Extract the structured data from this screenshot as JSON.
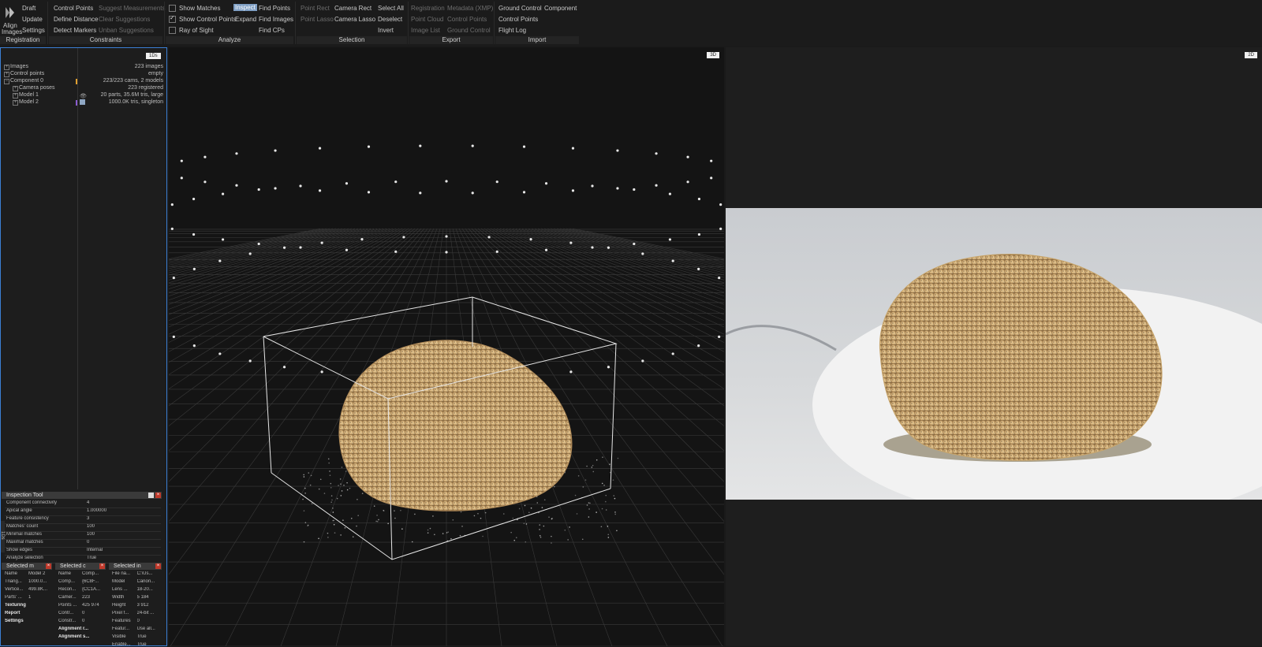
{
  "ribbon": {
    "registration": {
      "align_label_1": "Align",
      "align_label_2": "Images",
      "draft": "Draft",
      "update": "Update",
      "settings": "Settings",
      "group": "Registration"
    },
    "constraints": {
      "control_points": "Control Points",
      "define_distance": "Define Distance",
      "detect_markers": "Detect Markers",
      "suggest_measurements": "Suggest Measurements",
      "clear_suggestions": "Clear Suggestions",
      "unban_suggestions": "Unban Suggestions",
      "group": "Constraints"
    },
    "analyze": {
      "show_matches": "Show Matches",
      "show_control_points": "Show Control Points",
      "ray_of_sight": "Ray of Sight",
      "inspect": "Inspect",
      "expand": "Expand",
      "find_points": "Find Points",
      "find_images": "Find Images",
      "find_cps": "Find CPs",
      "group": "Analyze"
    },
    "selection": {
      "point_rect": "Point Rect",
      "point_lasso": "Point Lasso",
      "camera_rect": "Camera Rect",
      "camera_lasso": "Camera Lasso",
      "select_all": "Select All",
      "deselect": "Deselect",
      "invert": "Invert",
      "group": "Selection"
    },
    "export": {
      "registration": "Registration",
      "point_cloud": "Point Cloud",
      "image_list": "Image List",
      "metadata": "Metadata (XMP)",
      "control_points": "Control Points",
      "ground_control": "Ground Control",
      "group": "Export"
    },
    "import": {
      "ground_control": "Ground Control",
      "component": "Component",
      "control_points": "Control Points",
      "flight_log": "Flight Log",
      "group": "Import"
    }
  },
  "panel1": {
    "tag": "1Ds",
    "tree": [
      {
        "label": "Images",
        "value": "223 images"
      },
      {
        "label": "Control points",
        "value": "empty"
      },
      {
        "label": "Component 0",
        "value": "223/223 cams, 2 models"
      },
      {
        "label": "Camera poses",
        "value": "223 registered"
      },
      {
        "label": "Model 1",
        "value": "20 parts, 35.6M tris, large"
      },
      {
        "label": "Model 2",
        "value": "1000.0K tris, singleton"
      }
    ]
  },
  "viewport3d": {
    "tag": "3D"
  },
  "viewport2d": {
    "tag": "2D"
  },
  "inspection": {
    "title": "Inspection Tool",
    "rows": [
      {
        "k": "Component connectivity",
        "v": "4"
      },
      {
        "k": "Apical angle",
        "v": "1.000000"
      },
      {
        "k": "Feature consistency",
        "v": "3"
      },
      {
        "k": "Matches' count",
        "v": "100"
      },
      {
        "k": "Minimal matches",
        "v": "100"
      },
      {
        "k": "Maximal matches",
        "v": "0"
      },
      {
        "k": "Show edges",
        "v": "Internal"
      },
      {
        "k": "Analyze selection",
        "v": "True"
      }
    ],
    "side_label": "1Ds",
    "sel1": {
      "title": "Selected m",
      "rows": [
        {
          "k": "Name",
          "v": "Model 2"
        },
        {
          "k": "Triang...",
          "v": "1000.0..."
        },
        {
          "k": "Vertice...",
          "v": "499.8K..."
        },
        {
          "k": "Parts' ...",
          "v": "1"
        }
      ],
      "sections": [
        "Texturing",
        "Report",
        "Settings"
      ]
    },
    "sel2": {
      "title": "Selected c",
      "rows": [
        {
          "k": "Name",
          "v": "Comp..."
        },
        {
          "k": "Comp...",
          "v": "{6C8F..."
        },
        {
          "k": "Recon...",
          "v": "{CC1A..."
        },
        {
          "k": "Camer...",
          "v": "223"
        },
        {
          "k": "Points ...",
          "v": "425 974"
        },
        {
          "k": "Contr...",
          "v": "0"
        },
        {
          "k": "Constr...",
          "v": "0"
        }
      ],
      "sections": [
        "Alignment r...",
        "Alignment s..."
      ]
    },
    "sel3": {
      "title": "Selected in",
      "rows": [
        {
          "k": "File na...",
          "v": "C:\\Us..."
        },
        {
          "k": "Model",
          "v": "Canon..."
        },
        {
          "k": "Lens ...",
          "v": "18-20..."
        },
        {
          "k": "Width",
          "v": "5 184"
        },
        {
          "k": "Height",
          "v": "3 912"
        },
        {
          "k": "Pixel f...",
          "v": "24-bit ..."
        },
        {
          "k": "Features",
          "v": "0"
        },
        {
          "k": "Featur...",
          "v": "Use all..."
        },
        {
          "k": "Visible",
          "v": "True"
        },
        {
          "k": "Enable...",
          "v": "True"
        }
      ]
    }
  },
  "colors": {
    "accent": "#3b7fd4",
    "inspect_highlight": "#7f9fc4",
    "sponge": "#d9b47a"
  }
}
